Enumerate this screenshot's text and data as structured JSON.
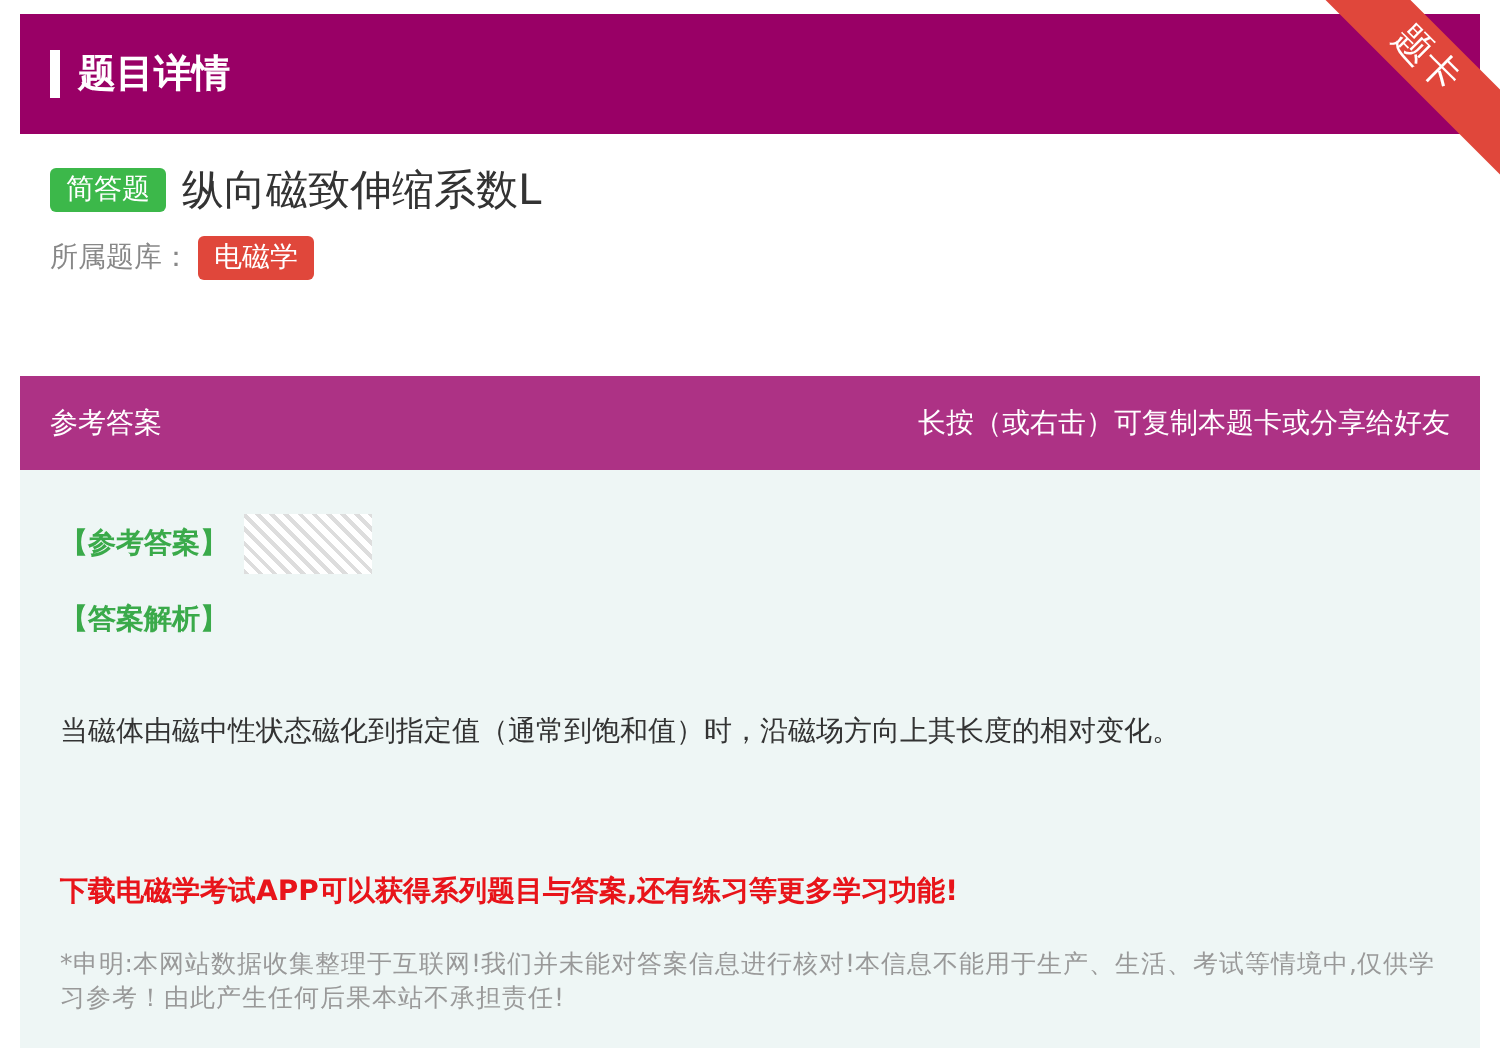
{
  "header": {
    "title": "题目详情",
    "ribbon": "题卡"
  },
  "question": {
    "type_tag": "简答题",
    "title": "纵向磁致伸缩系数L",
    "bank_label": "所属题库：",
    "bank_tag": "电磁学"
  },
  "answer_panel": {
    "title": "参考答案",
    "hint": "长按（或右击）可复制本题卡或分享给好友",
    "answer_label": "【参考答案】",
    "analysis_label": "【答案解析】",
    "analysis": "当磁体由磁中性状态磁化到指定值（通常到饱和值）时，沿磁场方向上其长度的相对变化。",
    "promo": "下载电磁学考试APP可以获得系列题目与答案,还有练习等更多学习功能!",
    "disclaimer": "*申明:本网站数据收集整理于互联网!我们并未能对答案信息进行核对!本信息不能用于生产、生活、考试等情境中,仅供学习参考！由此产生任何后果本站不承担责任!"
  }
}
